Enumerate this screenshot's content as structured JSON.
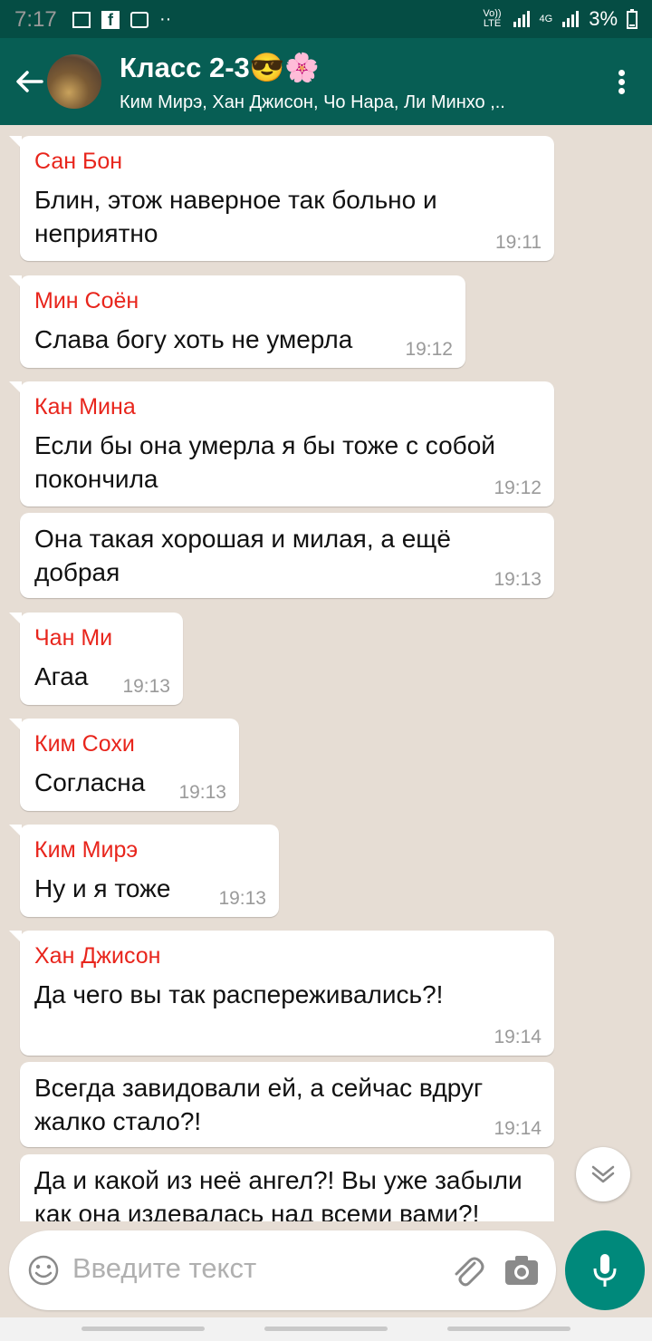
{
  "status_bar": {
    "time": "7:17",
    "network_label": "Vo)) LTE",
    "network_4g": "4G",
    "battery": "3%"
  },
  "header": {
    "title": "Класс 2-3😎🌸",
    "subtitle": "Ким Мирэ, Хан Джисон, Чо Нара, Ли Минхо ,.."
  },
  "messages": [
    {
      "sender": "Сан Бон",
      "text": "Блин, этож наверное так больно и неприятно",
      "time": "19:11"
    },
    {
      "sender": "Мин Соён",
      "text": "Слава богу хоть не умерла",
      "time": "19:12"
    },
    {
      "sender": "Кан Мина",
      "text": "Если бы она умерла я бы тоже с собой покончила",
      "time": "19:12"
    },
    {
      "sender": "",
      "text": "Она такая хорошая и милая, а ещё добрая",
      "time": "19:13"
    },
    {
      "sender": "Чан Ми",
      "text": "Агаа",
      "time": "19:13"
    },
    {
      "sender": "Ким Сохи",
      "text": "Согласна",
      "time": "19:13"
    },
    {
      "sender": "Ким Мирэ",
      "text": "Ну и я тоже",
      "time": "19:13"
    },
    {
      "sender": "Хан Джисон",
      "text": "Да чего вы так распереживались?!",
      "time": "19:14"
    },
    {
      "sender": "",
      "text": "Всегда завидовали ей, а сейчас вдруг жалко стало?!",
      "time": "19:14"
    },
    {
      "sender": "",
      "text": "Да и какой из неё ангел?! Вы уже забыли как она издевалась над всеми вами?!",
      "time": ""
    }
  ],
  "input": {
    "placeholder": "Введите текст"
  },
  "icons": {
    "back": "arrow-back-icon",
    "menu": "more-vert-icon",
    "emoji": "emoji-icon",
    "attach": "paperclip-icon",
    "camera": "camera-icon",
    "mic": "mic-icon",
    "scroll": "chevron-down-icon"
  },
  "colors": {
    "header": "#075e54",
    "status": "#054d44",
    "sender": "#e8251c",
    "mic": "#00897b"
  }
}
